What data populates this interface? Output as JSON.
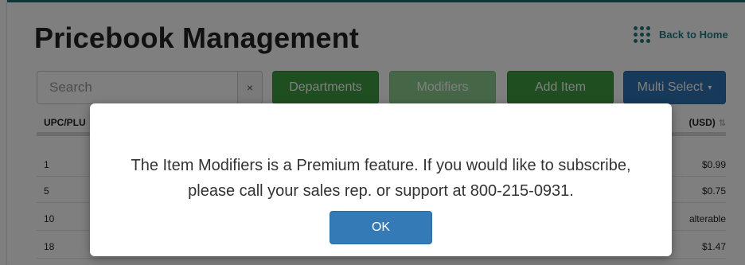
{
  "header": {
    "title": "Pricebook Management",
    "back_label": "Back to Home"
  },
  "toolbar": {
    "search_placeholder": "Search",
    "clear_label": "×",
    "departments_label": "Departments",
    "modifiers_label": "Modifiers",
    "add_item_label": "Add Item",
    "multi_select_label": "Multi Select",
    "multi_select_caret": "▾"
  },
  "table": {
    "columns": [
      "UPC/PLU",
      "(USD)"
    ],
    "sort_icon": "⇅",
    "rows": [
      {
        "upc": "1",
        "price": "$0.99"
      },
      {
        "upc": "5",
        "price": "$0.75"
      },
      {
        "upc": "10",
        "price": "alterable"
      },
      {
        "upc": "18",
        "price": "$1.47"
      }
    ]
  },
  "modal": {
    "line1": "The Item Modifiers is a Premium feature. If you would like to subscribe,",
    "line2": "please call your sales rep. or support at 800-215-0931.",
    "ok_label": "OK"
  },
  "colors": {
    "accent_teal": "#1f7f86",
    "green": "#3f9e43",
    "blue": "#2f74b6",
    "ok_blue": "#337ab7"
  }
}
